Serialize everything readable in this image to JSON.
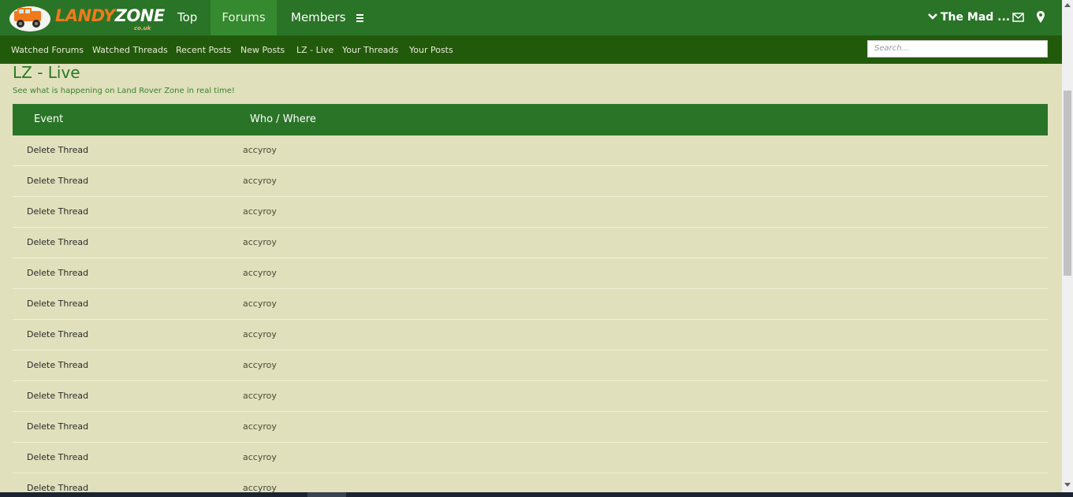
{
  "header": {
    "logo_text_orange": "LANDY",
    "logo_text_white": "ZONE",
    "logo_sub": "co.uk",
    "nav": [
      {
        "label": "Top"
      },
      {
        "label": "Forums"
      },
      {
        "label": "Members"
      }
    ],
    "user_label": "The Mad ...",
    "colors": {
      "bar": "#2a7428",
      "active_tab": "#358a2f",
      "subbar": "#225a0c"
    }
  },
  "subnav": {
    "links": [
      "Watched Forums",
      "Watched Threads",
      "Recent Posts",
      "New Posts",
      "LZ - Live",
      "Your Threads",
      "Your Posts"
    ],
    "search_placeholder": "Search..."
  },
  "page": {
    "title": "LZ - Live",
    "subtitle": "See what is happening on Land Rover Zone in real time!"
  },
  "table": {
    "headers": [
      "Event",
      "Who / Where"
    ],
    "rows": [
      [
        "Delete Thread",
        "accyroy"
      ],
      [
        "Delete Thread",
        "accyroy"
      ],
      [
        "Delete Thread",
        "accyroy"
      ],
      [
        "Delete Thread",
        "accyroy"
      ],
      [
        "Delete Thread",
        "accyroy"
      ],
      [
        "Delete Thread",
        "accyroy"
      ],
      [
        "Delete Thread",
        "accyroy"
      ],
      [
        "Delete Thread",
        "accyroy"
      ],
      [
        "Delete Thread",
        "accyroy"
      ],
      [
        "Delete Thread",
        "accyroy"
      ],
      [
        "Delete Thread",
        "accyroy"
      ],
      [
        "Delete Thread",
        "accyroy"
      ]
    ]
  }
}
